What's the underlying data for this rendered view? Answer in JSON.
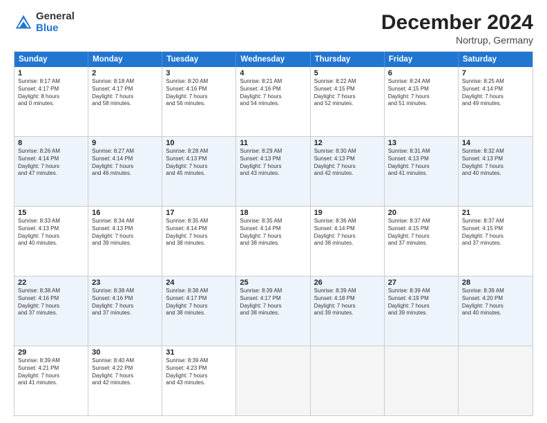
{
  "logo": {
    "general": "General",
    "blue": "Blue"
  },
  "header": {
    "month": "December 2024",
    "location": "Nortrup, Germany"
  },
  "days": [
    "Sunday",
    "Monday",
    "Tuesday",
    "Wednesday",
    "Thursday",
    "Friday",
    "Saturday"
  ],
  "weeks": [
    [
      {
        "day": "1",
        "lines": [
          "Sunrise: 8:17 AM",
          "Sunset: 4:17 PM",
          "Daylight: 8 hours",
          "and 0 minutes."
        ]
      },
      {
        "day": "2",
        "lines": [
          "Sunrise: 8:18 AM",
          "Sunset: 4:17 PM",
          "Daylight: 7 hours",
          "and 58 minutes."
        ]
      },
      {
        "day": "3",
        "lines": [
          "Sunrise: 8:20 AM",
          "Sunset: 4:16 PM",
          "Daylight: 7 hours",
          "and 56 minutes."
        ]
      },
      {
        "day": "4",
        "lines": [
          "Sunrise: 8:21 AM",
          "Sunset: 4:16 PM",
          "Daylight: 7 hours",
          "and 54 minutes."
        ]
      },
      {
        "day": "5",
        "lines": [
          "Sunrise: 8:22 AM",
          "Sunset: 4:15 PM",
          "Daylight: 7 hours",
          "and 52 minutes."
        ]
      },
      {
        "day": "6",
        "lines": [
          "Sunrise: 8:24 AM",
          "Sunset: 4:15 PM",
          "Daylight: 7 hours",
          "and 51 minutes."
        ]
      },
      {
        "day": "7",
        "lines": [
          "Sunrise: 8:25 AM",
          "Sunset: 4:14 PM",
          "Daylight: 7 hours",
          "and 49 minutes."
        ]
      }
    ],
    [
      {
        "day": "8",
        "lines": [
          "Sunrise: 8:26 AM",
          "Sunset: 4:14 PM",
          "Daylight: 7 hours",
          "and 47 minutes."
        ]
      },
      {
        "day": "9",
        "lines": [
          "Sunrise: 8:27 AM",
          "Sunset: 4:14 PM",
          "Daylight: 7 hours",
          "and 46 minutes."
        ]
      },
      {
        "day": "10",
        "lines": [
          "Sunrise: 8:28 AM",
          "Sunset: 4:13 PM",
          "Daylight: 7 hours",
          "and 45 minutes."
        ]
      },
      {
        "day": "11",
        "lines": [
          "Sunrise: 8:29 AM",
          "Sunset: 4:13 PM",
          "Daylight: 7 hours",
          "and 43 minutes."
        ]
      },
      {
        "day": "12",
        "lines": [
          "Sunrise: 8:30 AM",
          "Sunset: 4:13 PM",
          "Daylight: 7 hours",
          "and 42 minutes."
        ]
      },
      {
        "day": "13",
        "lines": [
          "Sunrise: 8:31 AM",
          "Sunset: 4:13 PM",
          "Daylight: 7 hours",
          "and 41 minutes."
        ]
      },
      {
        "day": "14",
        "lines": [
          "Sunrise: 8:32 AM",
          "Sunset: 4:13 PM",
          "Daylight: 7 hours",
          "and 40 minutes."
        ]
      }
    ],
    [
      {
        "day": "15",
        "lines": [
          "Sunrise: 8:33 AM",
          "Sunset: 4:13 PM",
          "Daylight: 7 hours",
          "and 40 minutes."
        ]
      },
      {
        "day": "16",
        "lines": [
          "Sunrise: 8:34 AM",
          "Sunset: 4:13 PM",
          "Daylight: 7 hours",
          "and 39 minutes."
        ]
      },
      {
        "day": "17",
        "lines": [
          "Sunrise: 8:35 AM",
          "Sunset: 4:14 PM",
          "Daylight: 7 hours",
          "and 38 minutes."
        ]
      },
      {
        "day": "18",
        "lines": [
          "Sunrise: 8:35 AM",
          "Sunset: 4:14 PM",
          "Daylight: 7 hours",
          "and 38 minutes."
        ]
      },
      {
        "day": "19",
        "lines": [
          "Sunrise: 8:36 AM",
          "Sunset: 4:14 PM",
          "Daylight: 7 hours",
          "and 38 minutes."
        ]
      },
      {
        "day": "20",
        "lines": [
          "Sunrise: 8:37 AM",
          "Sunset: 4:15 PM",
          "Daylight: 7 hours",
          "and 37 minutes."
        ]
      },
      {
        "day": "21",
        "lines": [
          "Sunrise: 8:37 AM",
          "Sunset: 4:15 PM",
          "Daylight: 7 hours",
          "and 37 minutes."
        ]
      }
    ],
    [
      {
        "day": "22",
        "lines": [
          "Sunrise: 8:38 AM",
          "Sunset: 4:16 PM",
          "Daylight: 7 hours",
          "and 37 minutes."
        ]
      },
      {
        "day": "23",
        "lines": [
          "Sunrise: 8:38 AM",
          "Sunset: 4:16 PM",
          "Daylight: 7 hours",
          "and 37 minutes."
        ]
      },
      {
        "day": "24",
        "lines": [
          "Sunrise: 8:38 AM",
          "Sunset: 4:17 PM",
          "Daylight: 7 hours",
          "and 38 minutes."
        ]
      },
      {
        "day": "25",
        "lines": [
          "Sunrise: 8:39 AM",
          "Sunset: 4:17 PM",
          "Daylight: 7 hours",
          "and 38 minutes."
        ]
      },
      {
        "day": "26",
        "lines": [
          "Sunrise: 8:39 AM",
          "Sunset: 4:18 PM",
          "Daylight: 7 hours",
          "and 39 minutes."
        ]
      },
      {
        "day": "27",
        "lines": [
          "Sunrise: 8:39 AM",
          "Sunset: 4:19 PM",
          "Daylight: 7 hours",
          "and 39 minutes."
        ]
      },
      {
        "day": "28",
        "lines": [
          "Sunrise: 8:39 AM",
          "Sunset: 4:20 PM",
          "Daylight: 7 hours",
          "and 40 minutes."
        ]
      }
    ],
    [
      {
        "day": "29",
        "lines": [
          "Sunrise: 8:39 AM",
          "Sunset: 4:21 PM",
          "Daylight: 7 hours",
          "and 41 minutes."
        ]
      },
      {
        "day": "30",
        "lines": [
          "Sunrise: 8:40 AM",
          "Sunset: 4:22 PM",
          "Daylight: 7 hours",
          "and 42 minutes."
        ]
      },
      {
        "day": "31",
        "lines": [
          "Sunrise: 8:39 AM",
          "Sunset: 4:23 PM",
          "Daylight: 7 hours",
          "and 43 minutes."
        ]
      },
      {
        "day": "",
        "lines": []
      },
      {
        "day": "",
        "lines": []
      },
      {
        "day": "",
        "lines": []
      },
      {
        "day": "",
        "lines": []
      }
    ]
  ]
}
